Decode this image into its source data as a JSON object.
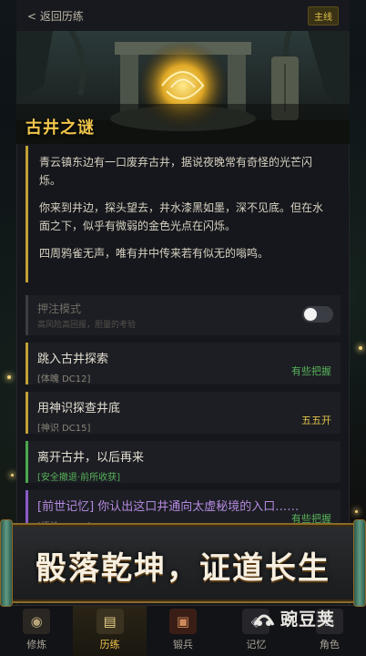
{
  "header": {
    "back_label": "< 返回历练",
    "tag": "主线"
  },
  "scene": {
    "title": "古井之谜"
  },
  "story": {
    "paragraphs": [
      "青云镇东边有一口废弃古井，据说夜晚常有奇怪的光芒闪烁。",
      "你来到井边，探头望去，井水漆黑如墨，深不见底。但在水面之下，似乎有微弱的金色光点在闪烁。",
      "四周鸦雀无声，唯有井中传来若有似无的嗡鸣。"
    ]
  },
  "mode": {
    "title": "押注模式",
    "subtitle": "高风险高回报，胆量的考验",
    "enabled": false
  },
  "choices": [
    {
      "label": "跳入古井探索",
      "check": "[体魄 DC12]",
      "odds": "有些把握",
      "check_color": "#8a8578",
      "odds_color": "#58b25a"
    },
    {
      "label": "用神识探查井底",
      "check": "[神识 DC15]",
      "odds": "五五开",
      "check_color": "#8a8578",
      "odds_color": "#e2c44a"
    },
    {
      "label": "离开古井，以后再来",
      "check": "[安全撤退·前所收获]",
      "odds": "",
      "check_color": "#58b25a",
      "odds_color": "#58b25a"
    },
    {
      "label": "[前世记忆] 你认出这口井通向太虚秘境的入口……",
      "check": "[悟性 DC10]",
      "odds": "有些把握",
      "check_color": "#8a8578",
      "odds_color": "#58b25a"
    }
  ],
  "promo": {
    "slogan": "骰落乾坤，证道长生"
  },
  "nav": {
    "items": [
      {
        "label": "修炼",
        "icon": "cultivate-icon"
      },
      {
        "label": "历练",
        "icon": "journey-icon"
      },
      {
        "label": "锻兵",
        "icon": "forge-icon"
      },
      {
        "label": "记忆",
        "icon": "memory-icon"
      },
      {
        "label": "角色",
        "icon": "character-icon"
      }
    ],
    "active": 1
  },
  "watermark": {
    "text": "豌豆荚"
  },
  "colors": {
    "accent": "#f1c64c",
    "gold_bar": "#c2a034",
    "green_bar": "#4aa84f",
    "purple_bar": "#8a5cc8",
    "bg": "#15171c"
  }
}
